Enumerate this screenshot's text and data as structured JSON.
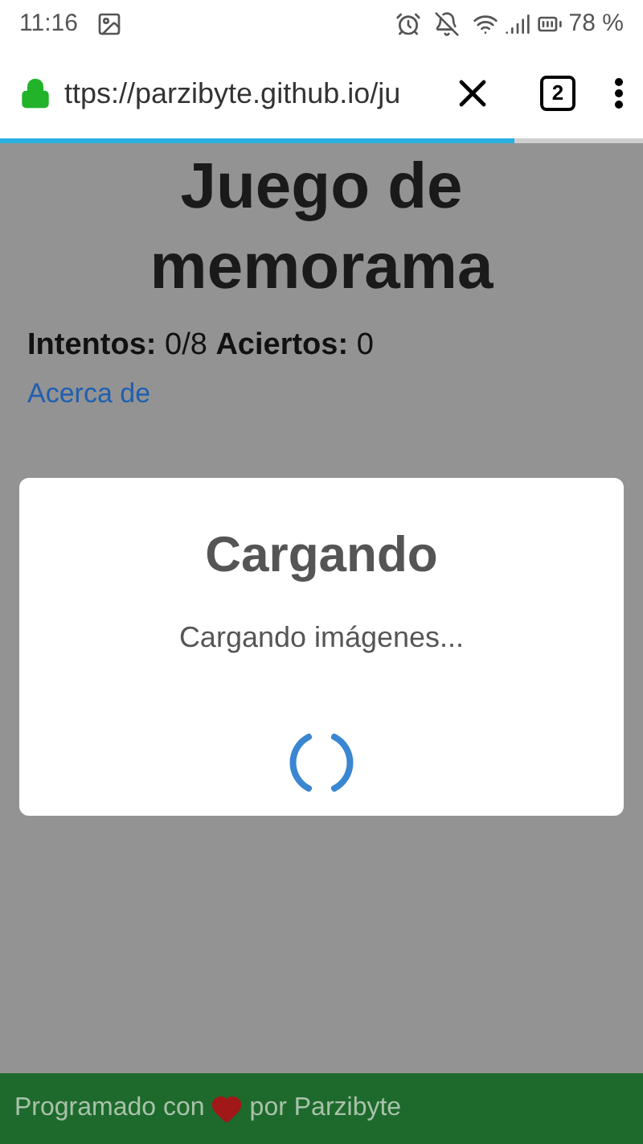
{
  "status_bar": {
    "time": "11:16",
    "battery": "78 %"
  },
  "browser": {
    "url": "ttps://parzibyte.github.io/ju",
    "tab_count": "2",
    "load_progress": {
      "level": 0.8
    }
  },
  "page": {
    "title": "Juego de memorama",
    "stats": "**Intentos:** 0/8 **Aciertos:** 0",
    "about_link": "Acerca de"
  },
  "dialog": {
    "title": "Cargando",
    "message": "Cargando imágenes..."
  },
  "footer": {
    "text_before": "Programado con",
    "text_after": "por Parzibyte"
  }
}
